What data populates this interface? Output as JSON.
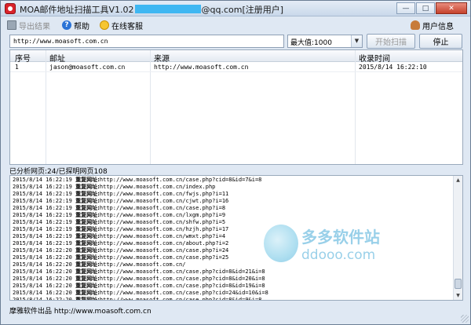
{
  "window": {
    "title_prefix": "MOA邮件地址扫描工具V1.02",
    "title_suffix": "@qq.com[注册用户]"
  },
  "window_controls": {
    "minimize": "—",
    "maximize": "□",
    "close": "✕"
  },
  "toolbar": {
    "export_label": "导出结果",
    "help_label": "帮助",
    "support_label": "在线客服",
    "user_info_label": "用户信息",
    "help_glyph": "?"
  },
  "url_input": {
    "value": "http://www.moasoft.com.cn"
  },
  "max_select": {
    "value": "最大值:1000",
    "arrow": "▼"
  },
  "buttons": {
    "start": "开始扫描",
    "stop": "停止"
  },
  "table": {
    "headers": [
      "序号",
      "邮址",
      "来源",
      "收录时间"
    ],
    "rows": [
      [
        "1",
        "jason@moasoft.com.cn",
        "http://www.moasoft.com.cn",
        "2015/8/14 16:22:10"
      ]
    ]
  },
  "status": "已分析网页:24/已探明网页108",
  "log": {
    "label": "重复网址:",
    "lines": [
      [
        "2015/8/14 16:22:19",
        "http://www.moasoft.com.cn/case.php?cid=8&id=7&i=8"
      ],
      [
        "2015/8/14 16:22:19",
        "http://www.moasoft.com.cn/index.php"
      ],
      [
        "2015/8/14 16:22:19",
        "http://www.moasoft.com.cn/fwjs.php?i=11"
      ],
      [
        "2015/8/14 16:22:19",
        "http://www.moasoft.com.cn/cjwt.php?i=16"
      ],
      [
        "2015/8/14 16:22:19",
        "http://www.moasoft.com.cn/case.php?i=8"
      ],
      [
        "2015/8/14 16:22:19",
        "http://www.moasoft.com.cn/lxgm.php?i=9"
      ],
      [
        "2015/8/14 16:22:19",
        "http://www.moasoft.com.cn/shfw.php?i=5"
      ],
      [
        "2015/8/14 16:22:19",
        "http://www.moasoft.com.cn/hzjh.php?i=17"
      ],
      [
        "2015/8/14 16:22:19",
        "http://www.moasoft.com.cn/wmxt.php?i=4"
      ],
      [
        "2015/8/14 16:22:19",
        "http://www.moasoft.com.cn/about.php?i=2"
      ],
      [
        "2015/8/14 16:22:20",
        "http://www.moasoft.com.cn/case.php?i=24"
      ],
      [
        "2015/8/14 16:22:20",
        "http://www.moasoft.com.cn/case.php?i=25"
      ],
      [
        "2015/8/14 16:22:20",
        "http://www.moasoft.com.cn/"
      ],
      [
        "2015/8/14 16:22:20",
        "http://www.moasoft.com.cn/case.php?cid=8&id=21&i=8"
      ],
      [
        "2015/8/14 16:22:20",
        "http://www.moasoft.com.cn/case.php?cid=8&id=20&i=8"
      ],
      [
        "2015/8/14 16:22:20",
        "http://www.moasoft.com.cn/case.php?cid=8&id=19&i=8"
      ],
      [
        "2015/8/14 16:22:20",
        "http://www.moasoft.com.cn/case.php?cid=24&id=10&i=8"
      ],
      [
        "2015/8/14 16:22:20",
        "http://www.moasoft.com.cn/case.php?cid=8&id=9&i=8"
      ],
      [
        "2015/8/14 16:22:20",
        "http://www.moasoft.com.cn/case.php?cid=8&id=8&i=8"
      ],
      [
        "2015/8/14 16:22:20",
        "http://www.moasoft.com.cn/case.php?cid=8&id=7&i=8"
      ]
    ]
  },
  "watermark": {
    "title": "多多软件站",
    "subtitle": "ddooo.com"
  },
  "footer": "摩雅软件出品 http://www.moasoft.com.cn",
  "colors": {
    "title_mask": "#3fb7f2",
    "close_button": "#c5412b",
    "window_bg": "#dfe8f3"
  },
  "icons": {
    "app": "app-icon",
    "export": "export-icon",
    "help": "help-icon",
    "support": "smile-icon",
    "user": "user-icon"
  }
}
